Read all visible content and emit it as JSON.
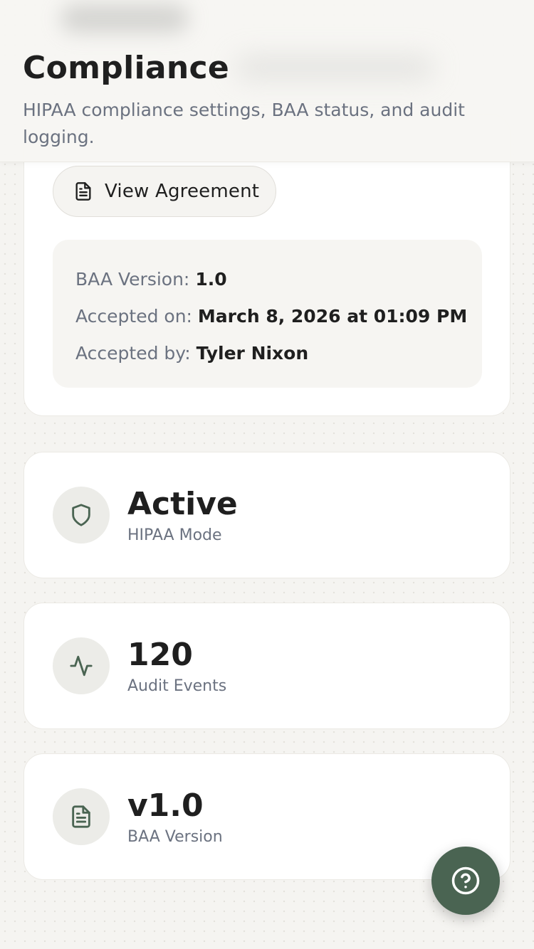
{
  "header": {
    "title": "Compliance",
    "subtitle": "HIPAA compliance settings, BAA status, and audit logging."
  },
  "baa_card": {
    "view_button_label": "View Agreement",
    "view_button_icon": "file-text-icon",
    "version_label": "BAA Version:",
    "version_value": "1.0",
    "accepted_on_label": "Accepted on:",
    "accepted_on_value": "March 8, 2026 at 01:09 PM",
    "accepted_by_label": "Accepted by:",
    "accepted_by_value": "Tyler Nixon"
  },
  "stats": [
    {
      "icon": "shield-icon",
      "value": "Active",
      "label": "HIPAA Mode"
    },
    {
      "icon": "activity-icon",
      "value": "120",
      "label": "Audit Events"
    },
    {
      "icon": "file-text-icon",
      "value": "v1.0",
      "label": "BAA Version"
    }
  ],
  "help_fab": {
    "icon": "help-circle-icon"
  },
  "colors": {
    "accent": "#4a6452",
    "muted_text": "#6b7280",
    "card_bg": "#ffffff",
    "page_bg": "#f5f4f1"
  }
}
